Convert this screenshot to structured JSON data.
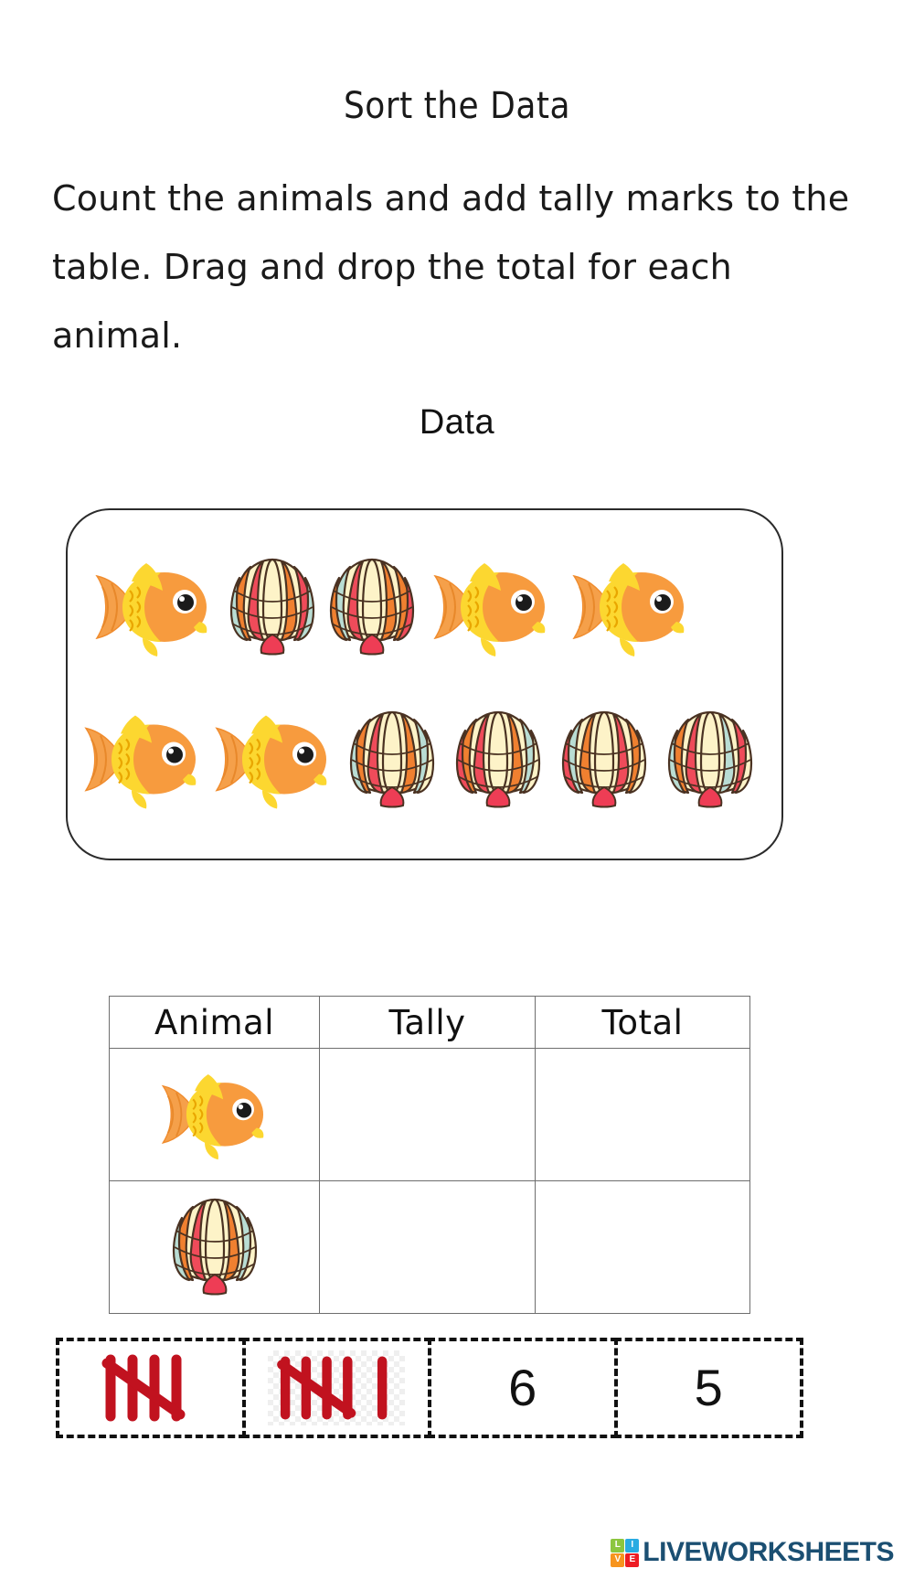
{
  "worksheet": {
    "title": "Sort the Data",
    "instructions": "Count the animals and add tally marks to the table. Drag and drop the total for each animal.",
    "data_label": "Data"
  },
  "data_box": {
    "rows": [
      [
        "fish-icon",
        "shell-icon",
        "shell-icon",
        "fish-icon",
        "fish-icon"
      ],
      [
        "fish-icon",
        "fish-icon",
        "shell-icon",
        "shell-icon",
        "shell-icon",
        "shell-icon"
      ]
    ],
    "counts": {
      "fish": 5,
      "shell": 6
    }
  },
  "table": {
    "headers": [
      "Animal",
      "Tally",
      "Total"
    ],
    "rows": [
      {
        "animal_icon": "fish-icon",
        "tally": "",
        "total": ""
      },
      {
        "animal_icon": "shell-icon",
        "tally": "",
        "total": ""
      }
    ]
  },
  "answer_strip": {
    "items": [
      {
        "kind": "tally",
        "value": 5,
        "label": "tally-5",
        "transparent": false
      },
      {
        "kind": "tally",
        "value": 6,
        "label": "tally-6",
        "transparent": true
      },
      {
        "kind": "number",
        "value": "6"
      },
      {
        "kind": "number",
        "value": "5"
      }
    ]
  },
  "footer": {
    "logo_tiles": [
      "L",
      "I",
      "V",
      "E"
    ],
    "wordmark": "LIVEWORKSHEETS"
  },
  "colors": {
    "tally_red": "#c1121f",
    "logo_blue": "#1b4f72",
    "tile_l": "#8cc63f",
    "tile_i": "#29abe2",
    "tile_v": "#f7941e",
    "tile_e": "#ed1c24",
    "border": "#2b2b2b"
  }
}
